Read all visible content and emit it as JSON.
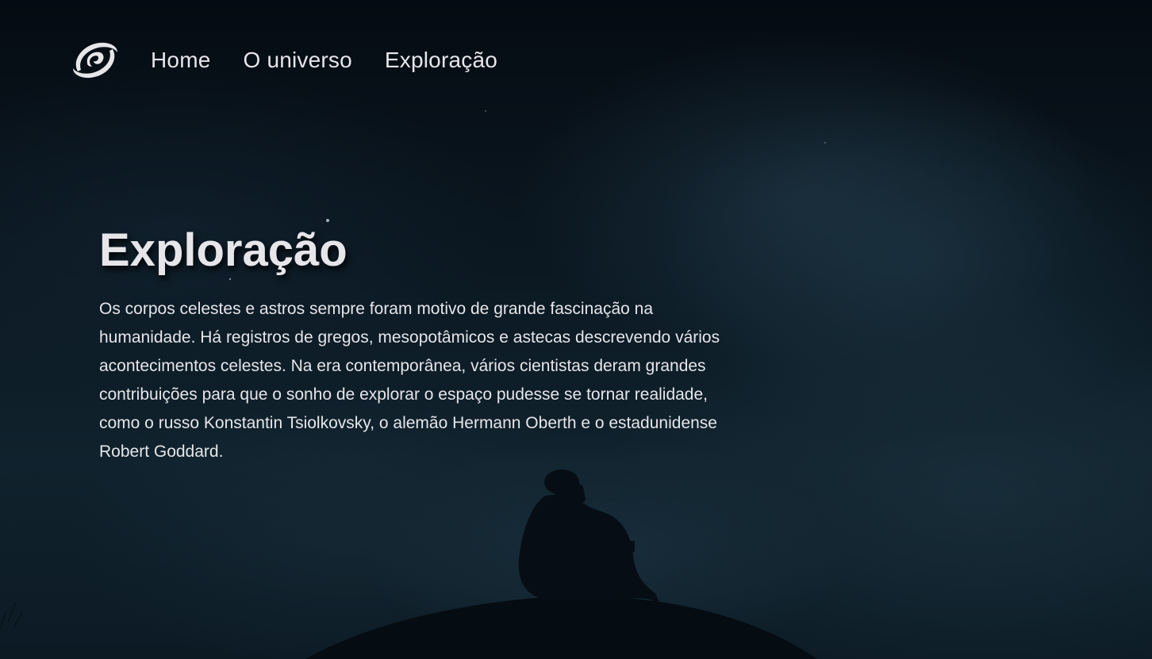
{
  "nav": {
    "logo_icon": "spiral-galaxy-icon",
    "links": [
      {
        "label": "Home"
      },
      {
        "label": "O universo"
      },
      {
        "label": "Exploração"
      }
    ]
  },
  "hero": {
    "title": "Exploração",
    "text": "Os corpos celestes e astros sempre foram motivo de grande fascinação na humanidade. Há registros de gregos, mesopotâmicos e astecas descrevendo vários acontecimentos celestes. Na era contemporânea, vários cientistas deram grandes contribuições para que o sonho de explorar o espaço pudesse se tornar realidade, como o russo Konstantin Tsiolkovsky, o alemão Hermann Oberth e o estadunidense Robert Goddard."
  },
  "colors": {
    "text": "#e6e6ea",
    "background_dark": "#07101a",
    "background_mid": "#10222d"
  }
}
